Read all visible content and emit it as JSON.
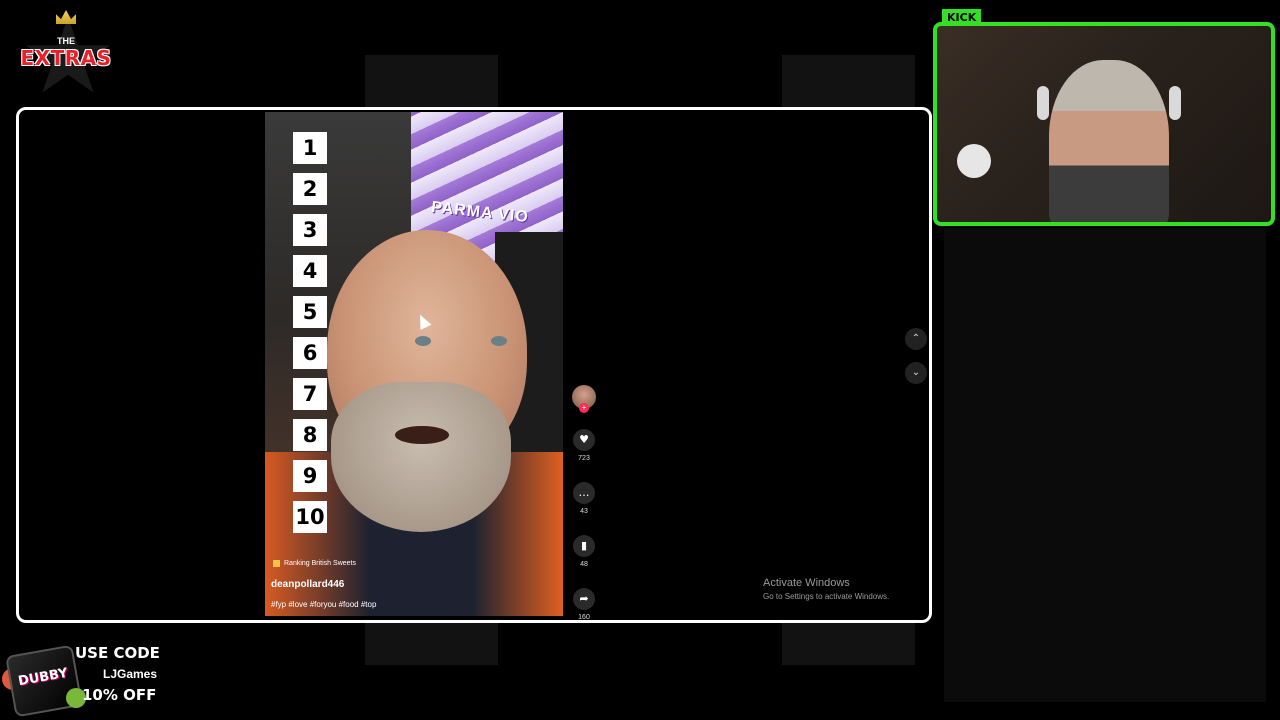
{
  "overlay": {
    "logo_top": "THE",
    "logo_text": "EXTRAS",
    "promo": {
      "line1": "USE CODE",
      "code": "LJGames",
      "discount": "10% OFF",
      "product": "DUBBY"
    },
    "cam_badge": "KICK",
    "accent_color": "#34e024"
  },
  "video": {
    "ranks": [
      "1",
      "2",
      "3",
      "4",
      "5",
      "6",
      "7",
      "8",
      "9",
      "10"
    ],
    "candy_text": "PARMA VIO",
    "tag": "Ranking British Sweets",
    "username": "deanpollard446",
    "hashtags": "#fyp #love #foryou #food #top",
    "actions": {
      "likes": "723",
      "comments": "43",
      "saves": "48",
      "shares": "160"
    },
    "icons": [
      "heart-icon",
      "comment-icon",
      "bookmark-icon",
      "share-icon"
    ]
  },
  "nav": {
    "up": "⌃",
    "down": "⌄"
  },
  "system": {
    "activate_title": "Activate Windows",
    "activate_sub": "Go to Settings to activate Windows."
  }
}
